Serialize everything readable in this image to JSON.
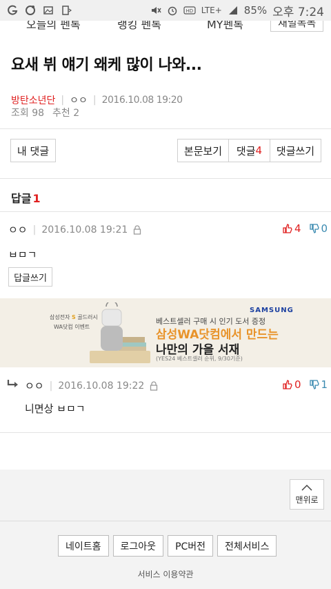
{
  "status_bar": {
    "battery": "85%",
    "time": "오후 7:24",
    "network": "LTE+"
  },
  "top_tabs": [
    "오늘의 펜톡",
    "랭킹 펜톡",
    "MY펜톡",
    "재밀폭독"
  ],
  "post": {
    "title": "요새 뷔 얘기 왜케 많이 나와...",
    "board": "방탄소년단",
    "author": "ㅇㅇ",
    "date": "2016.10.08 19:20",
    "views": "조회 98",
    "recommends": "추천 2"
  },
  "buttons": {
    "my_comment": "내 댓글",
    "view_body": "본문보기",
    "comments_label": "댓글",
    "comments_count": "4",
    "write_comment": "댓글쓰기"
  },
  "replies": {
    "label": "답글",
    "count": "1"
  },
  "comments": [
    {
      "author": "ㅇㅇ",
      "date": "2016.10.08 19:21",
      "up": "4",
      "down": "0",
      "body": "ㅂㅁㄱ",
      "reply_button": "답글쓰기"
    },
    {
      "author": "ㅇㅇ",
      "date": "2016.10.08 19:22",
      "up": "0",
      "down": "1",
      "body": "니면상 ㅂㅁㄱ"
    }
  ],
  "ad": {
    "brand_left": "삼성전자",
    "brand_highlight": "S",
    "brand_tail": "골드러시",
    "event": "WA닷컴 이벤트",
    "samsung": "SAMSUNG",
    "line1": "베스트셀러 구매 시 인기 도서 증정",
    "line2": "삼성WA닷컴에서 만드는",
    "line3": "나만의 가을 서재",
    "line4": "(YES24 베스트셀러 순위, 9/30기준)"
  },
  "to_top": "맨위로",
  "footer": {
    "buttons": [
      "네이트홈",
      "로그아웃",
      "PC버전",
      "전체서비스"
    ],
    "link": "서비스 이용약관"
  },
  "colors": {
    "accent_red": "#e02020",
    "down_blue": "#3a8ab0",
    "ad_orange": "#e8932a",
    "samsung_blue": "#1a3fa0"
  }
}
